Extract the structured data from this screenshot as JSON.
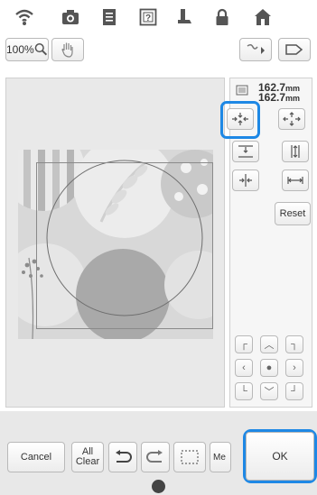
{
  "toolbar": {
    "icons": [
      "wifi-icon",
      "camera-icon",
      "document-icon",
      "help-icon",
      "embroidery-foot-icon",
      "lock-icon",
      "home-icon"
    ]
  },
  "view": {
    "zoom_label": "100%",
    "hand_icon": "hand-icon"
  },
  "size": {
    "width": "162.7",
    "height": "162.7",
    "unit": "mm"
  },
  "panel": {
    "reset_label": "Reset"
  },
  "bottom": {
    "cancel_label": "Cancel",
    "all_clear_line1": "All",
    "all_clear_line2": "Clear",
    "me_label": "Me",
    "ok_label": "OK"
  },
  "colors": {
    "accent": "#1e88e5",
    "background": "#ffffff",
    "canvas": "#e9e9e9",
    "bottom_bar": "#e8e8e8"
  }
}
